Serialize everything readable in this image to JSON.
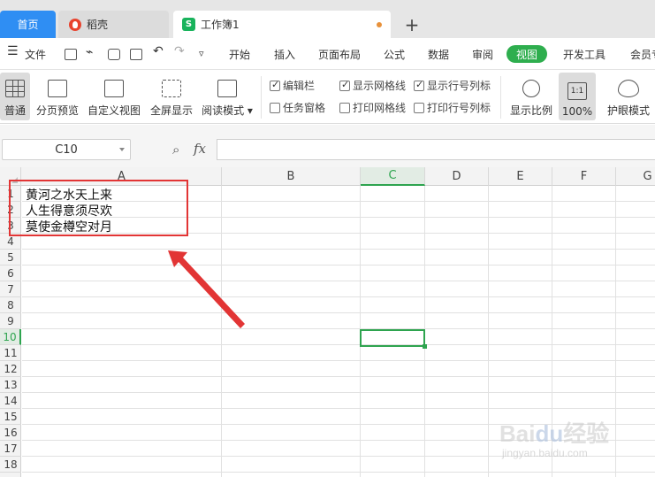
{
  "tabs": {
    "home": "首页",
    "daoke": "稻壳",
    "workbook": "工作簿1",
    "new_tab": "+"
  },
  "menu": {
    "hamburger_label": "文件",
    "items": [
      "开始",
      "插入",
      "页面布局",
      "公式",
      "数据",
      "审阅",
      "视图",
      "开发工具",
      "会员专"
    ],
    "active": "视图"
  },
  "ribbon": {
    "normal": "普通",
    "page_break_preview": "分页预览",
    "custom_view": "自定义视图",
    "full_screen": "全屏显示",
    "reading_mode": "阅读模式",
    "checkboxes": {
      "formula_bar": {
        "label": "编辑栏",
        "checked": true
      },
      "task_pane": {
        "label": "任务窗格",
        "checked": false
      },
      "show_gridlines": {
        "label": "显示网格线",
        "checked": true
      },
      "print_gridlines": {
        "label": "打印网格线",
        "checked": false
      },
      "show_headings": {
        "label": "显示行号列标",
        "checked": true
      },
      "print_headings": {
        "label": "打印行号列标",
        "checked": false
      }
    },
    "zoom": "显示比例",
    "zoom_100": "100%",
    "zoom_100_icon": "1:1",
    "eye_protection": "护眼模式"
  },
  "formula_bar": {
    "name_box": "C10",
    "fx": "fx",
    "formula": ""
  },
  "columns": [
    "A",
    "B",
    "C",
    "D",
    "E",
    "F",
    "G"
  ],
  "selected_column": "C",
  "rows": [
    "1",
    "2",
    "3",
    "4",
    "5",
    "6",
    "7",
    "8",
    "9",
    "10",
    "11",
    "12",
    "13",
    "14",
    "15",
    "16",
    "17",
    "18"
  ],
  "selected_row": "10",
  "cells": {
    "A1": "黄河之水天上来",
    "A2": "人生得意须尽欢",
    "A3": "莫使金樽空对月"
  },
  "colors": {
    "accent_green": "#2eae4e",
    "tab_blue": "#2f8ef3",
    "annotation_red": "#e23535"
  },
  "watermark": {
    "logo": "Baidu经验",
    "url": "jingyan.baidu.com"
  }
}
